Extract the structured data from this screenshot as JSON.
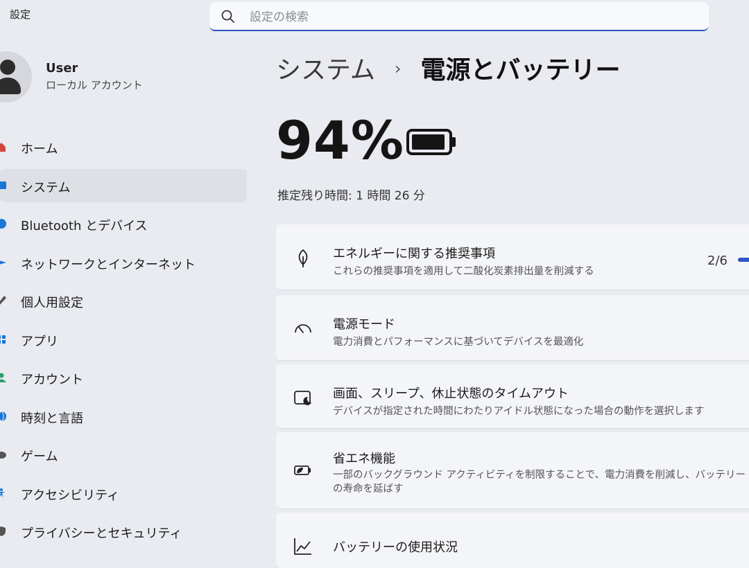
{
  "app": {
    "title": "設定"
  },
  "search": {
    "placeholder": "設定の検索"
  },
  "profile": {
    "name": "User",
    "account_type": "ローカル アカウント"
  },
  "sidebar": {
    "items": [
      {
        "label": "ホーム",
        "icon": "home-icon",
        "color": "#d0463d"
      },
      {
        "label": "システム",
        "icon": "system-icon",
        "color": "#1976d2",
        "selected": true
      },
      {
        "label": "Bluetooth とデバイス",
        "icon": "bluetooth-icon",
        "color": "#1976d2"
      },
      {
        "label": "ネットワークとインターネット",
        "icon": "network-icon",
        "color": "#1976d2"
      },
      {
        "label": "個人用設定",
        "icon": "brush-icon",
        "color": "#555555"
      },
      {
        "label": "アプリ",
        "icon": "apps-icon",
        "color": "#1976d2"
      },
      {
        "label": "アカウント",
        "icon": "account-icon",
        "color": "#2e9e6b"
      },
      {
        "label": "時刻と言語",
        "icon": "globe-icon",
        "color": "#1976d2"
      },
      {
        "label": "ゲーム",
        "icon": "gamepad-icon",
        "color": "#555555"
      },
      {
        "label": "アクセシビリティ",
        "icon": "accessibility-icon",
        "color": "#1976d2"
      },
      {
        "label": "プライバシーとセキュリティ",
        "icon": "shield-icon",
        "color": "#555555"
      }
    ]
  },
  "breadcrumb": {
    "parent": "システム",
    "separator": "›",
    "current": "電源とバッテリー"
  },
  "battery": {
    "percent": "94%",
    "level": 0.94,
    "remaining": "推定残り時間: 1 時間 26 分"
  },
  "cards": [
    {
      "title": "エネルギーに関する推奨事項",
      "desc": "これらの推奨事項を適用して二酸化炭素排出量を削減する",
      "progress": "2/6",
      "icon": "leaf-icon"
    },
    {
      "title": "電源モード",
      "desc": "電力消費とパフォーマンスに基づいてデバイスを最適化",
      "icon": "gauge-icon"
    },
    {
      "title": "画面、スリープ、休止状態のタイムアウト",
      "desc": "デバイスが指定された時間にわたりアイドル状態になった場合の動作を選択します",
      "icon": "screen-sleep-icon"
    },
    {
      "title": "省エネ機能",
      "desc": "一部のバックグラウンド アクティビティを制限することで、電力消費を削減し、バッテリーの寿命を延ばす",
      "icon": "battery-saver-icon"
    },
    {
      "title": "バッテリーの使用状況",
      "icon": "chart-icon"
    }
  ],
  "colors": {
    "accent": "#2a56c6",
    "background": "#e9ebf1",
    "card": "#f4f5f8"
  }
}
